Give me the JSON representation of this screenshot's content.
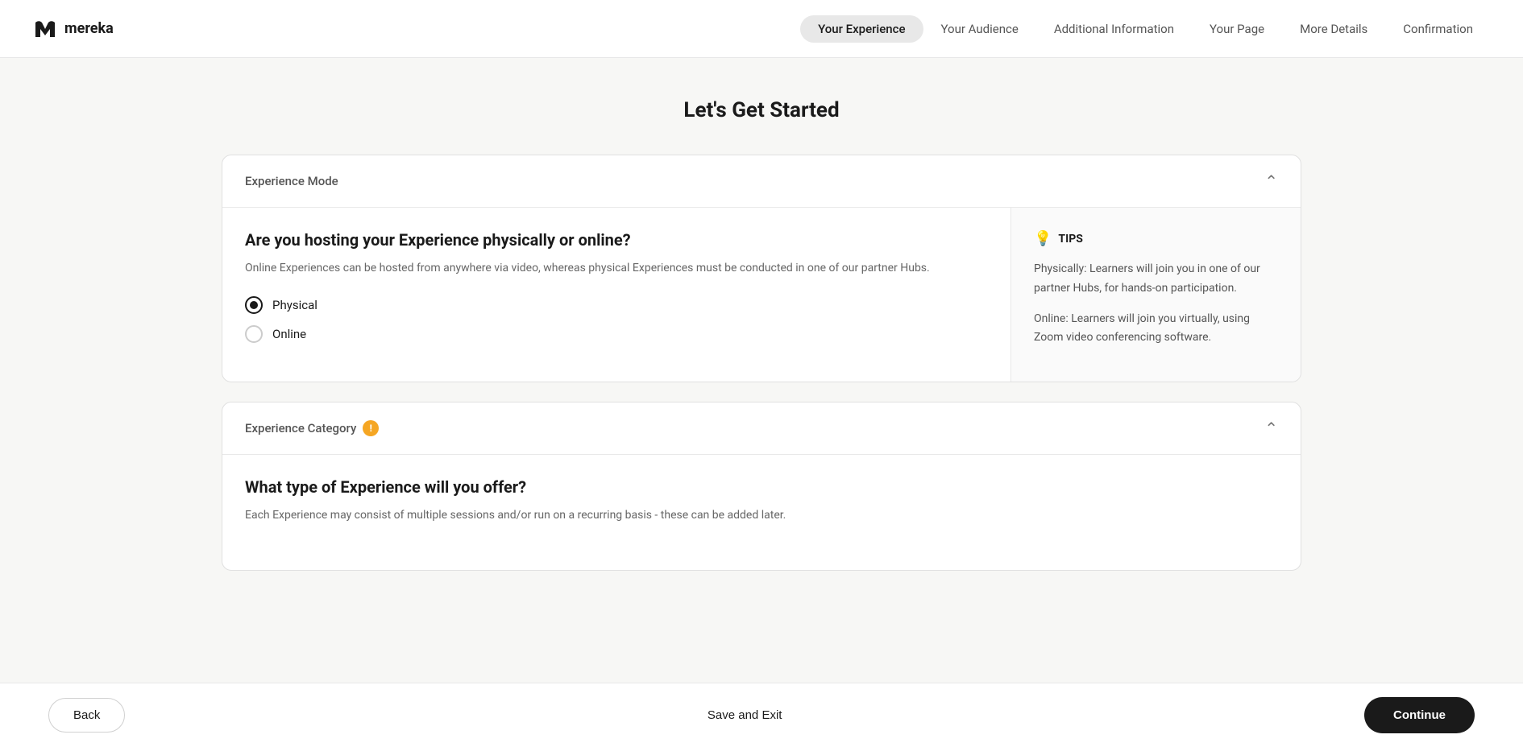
{
  "logo": {
    "name": "mereka"
  },
  "nav": {
    "items": [
      {
        "id": "your-experience",
        "label": "Your Experience",
        "active": true
      },
      {
        "id": "your-audience",
        "label": "Your Audience",
        "active": false
      },
      {
        "id": "additional-information",
        "label": "Additional Information",
        "active": false
      },
      {
        "id": "your-page",
        "label": "Your Page",
        "active": false
      },
      {
        "id": "more-details",
        "label": "More Details",
        "active": false
      },
      {
        "id": "confirmation",
        "label": "Confirmation",
        "active": false
      }
    ]
  },
  "page": {
    "title": "Let's Get Started"
  },
  "experience_mode_card": {
    "section_label": "Experience Mode",
    "question": "Are you hosting your Experience physically or online?",
    "description": "Online Experiences can be hosted from anywhere via video, whereas physical Experiences must be conducted in one of our partner Hubs.",
    "options": [
      {
        "id": "physical",
        "label": "Physical",
        "checked": true
      },
      {
        "id": "online",
        "label": "Online",
        "checked": false
      }
    ],
    "tips_header": "TIPS",
    "tips": [
      "Physically: Learners will join you in one of our partner Hubs, for hands-on participation.",
      "Online: Learners will join you virtually, using Zoom video conferencing software."
    ]
  },
  "experience_category_card": {
    "section_label": "Experience Category",
    "has_warning": true,
    "question": "What type of Experience will you offer?",
    "description": "Each Experience may consist of multiple sessions and/or run on a recurring basis - these can be added later."
  },
  "footer": {
    "back_label": "Back",
    "save_label": "Save and Exit",
    "continue_label": "Continue"
  }
}
